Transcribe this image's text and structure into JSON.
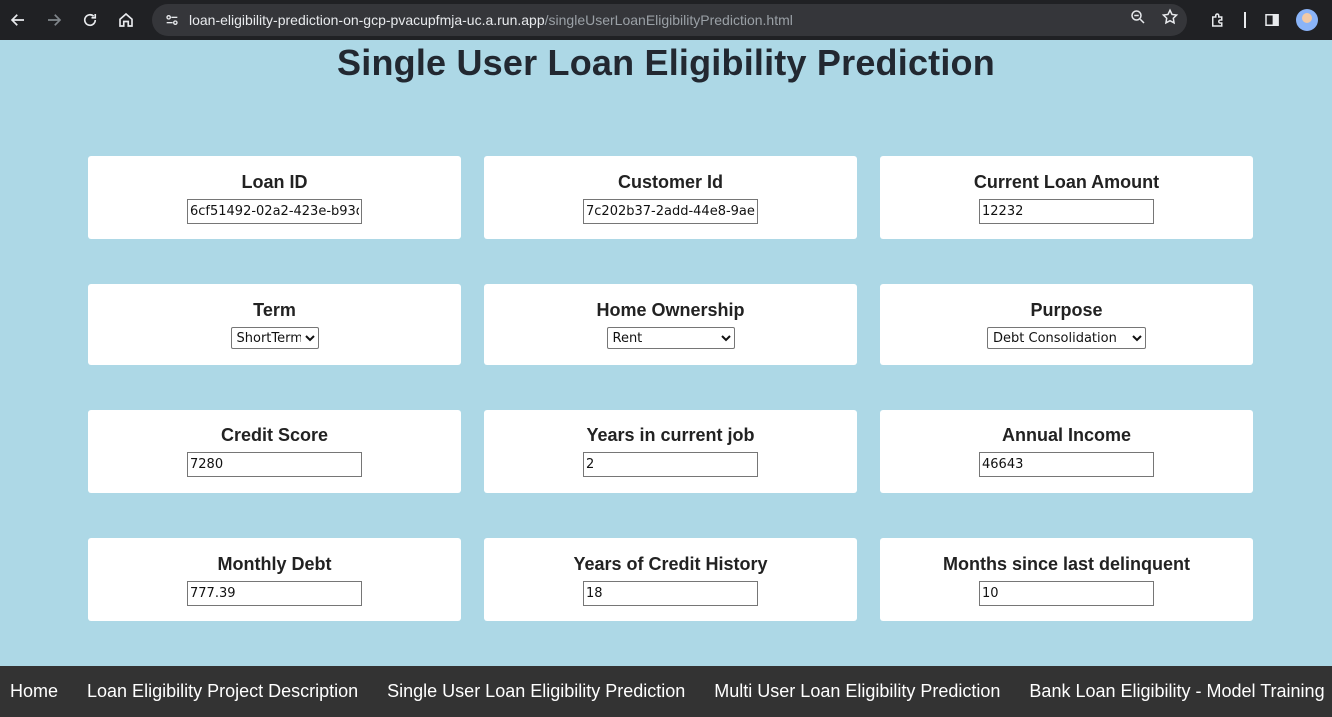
{
  "browser": {
    "url_host": "loan-eligibility-prediction-on-gcp-pvacupfmja-uc.a.run.app",
    "url_path": "/singleUserLoanEligibilityPrediction.html"
  },
  "page": {
    "title": "Single User Loan Eligibility Prediction"
  },
  "form": {
    "loan_id": {
      "label": "Loan ID",
      "value": "6cf51492-02a2-423e-b93d"
    },
    "customer_id": {
      "label": "Customer Id",
      "value": "7c202b37-2add-44e8-9aea"
    },
    "current_loan_amount": {
      "label": "Current Loan Amount",
      "value": "12232"
    },
    "term": {
      "label": "Term",
      "selected": "ShortTerm"
    },
    "home_ownership": {
      "label": "Home Ownership",
      "selected": "Rent"
    },
    "purpose": {
      "label": "Purpose",
      "selected": "Debt Consolidation"
    },
    "credit_score": {
      "label": "Credit Score",
      "value": "7280"
    },
    "years_in_job": {
      "label": "Years in current job",
      "value": "2"
    },
    "annual_income": {
      "label": "Annual Income",
      "value": "46643"
    },
    "monthly_debt": {
      "label": "Monthly Debt",
      "value": "777.39"
    },
    "years_credit_history": {
      "label": "Years of Credit History",
      "value": "18"
    },
    "months_since_delinquent": {
      "label": "Months since last delinquent",
      "value": "10"
    }
  },
  "footer_nav": {
    "home": "Home",
    "description": "Loan Eligibility Project Description",
    "single": "Single User Loan Eligibility Prediction",
    "multi": "Multi User Loan Eligibility Prediction",
    "training": "Bank Loan Eligibility - Model Training"
  },
  "colors": {
    "page_bg": "#add8e6",
    "card_bg": "#ffffff",
    "footer_bg": "#333333",
    "chrome_bg": "#202124"
  }
}
